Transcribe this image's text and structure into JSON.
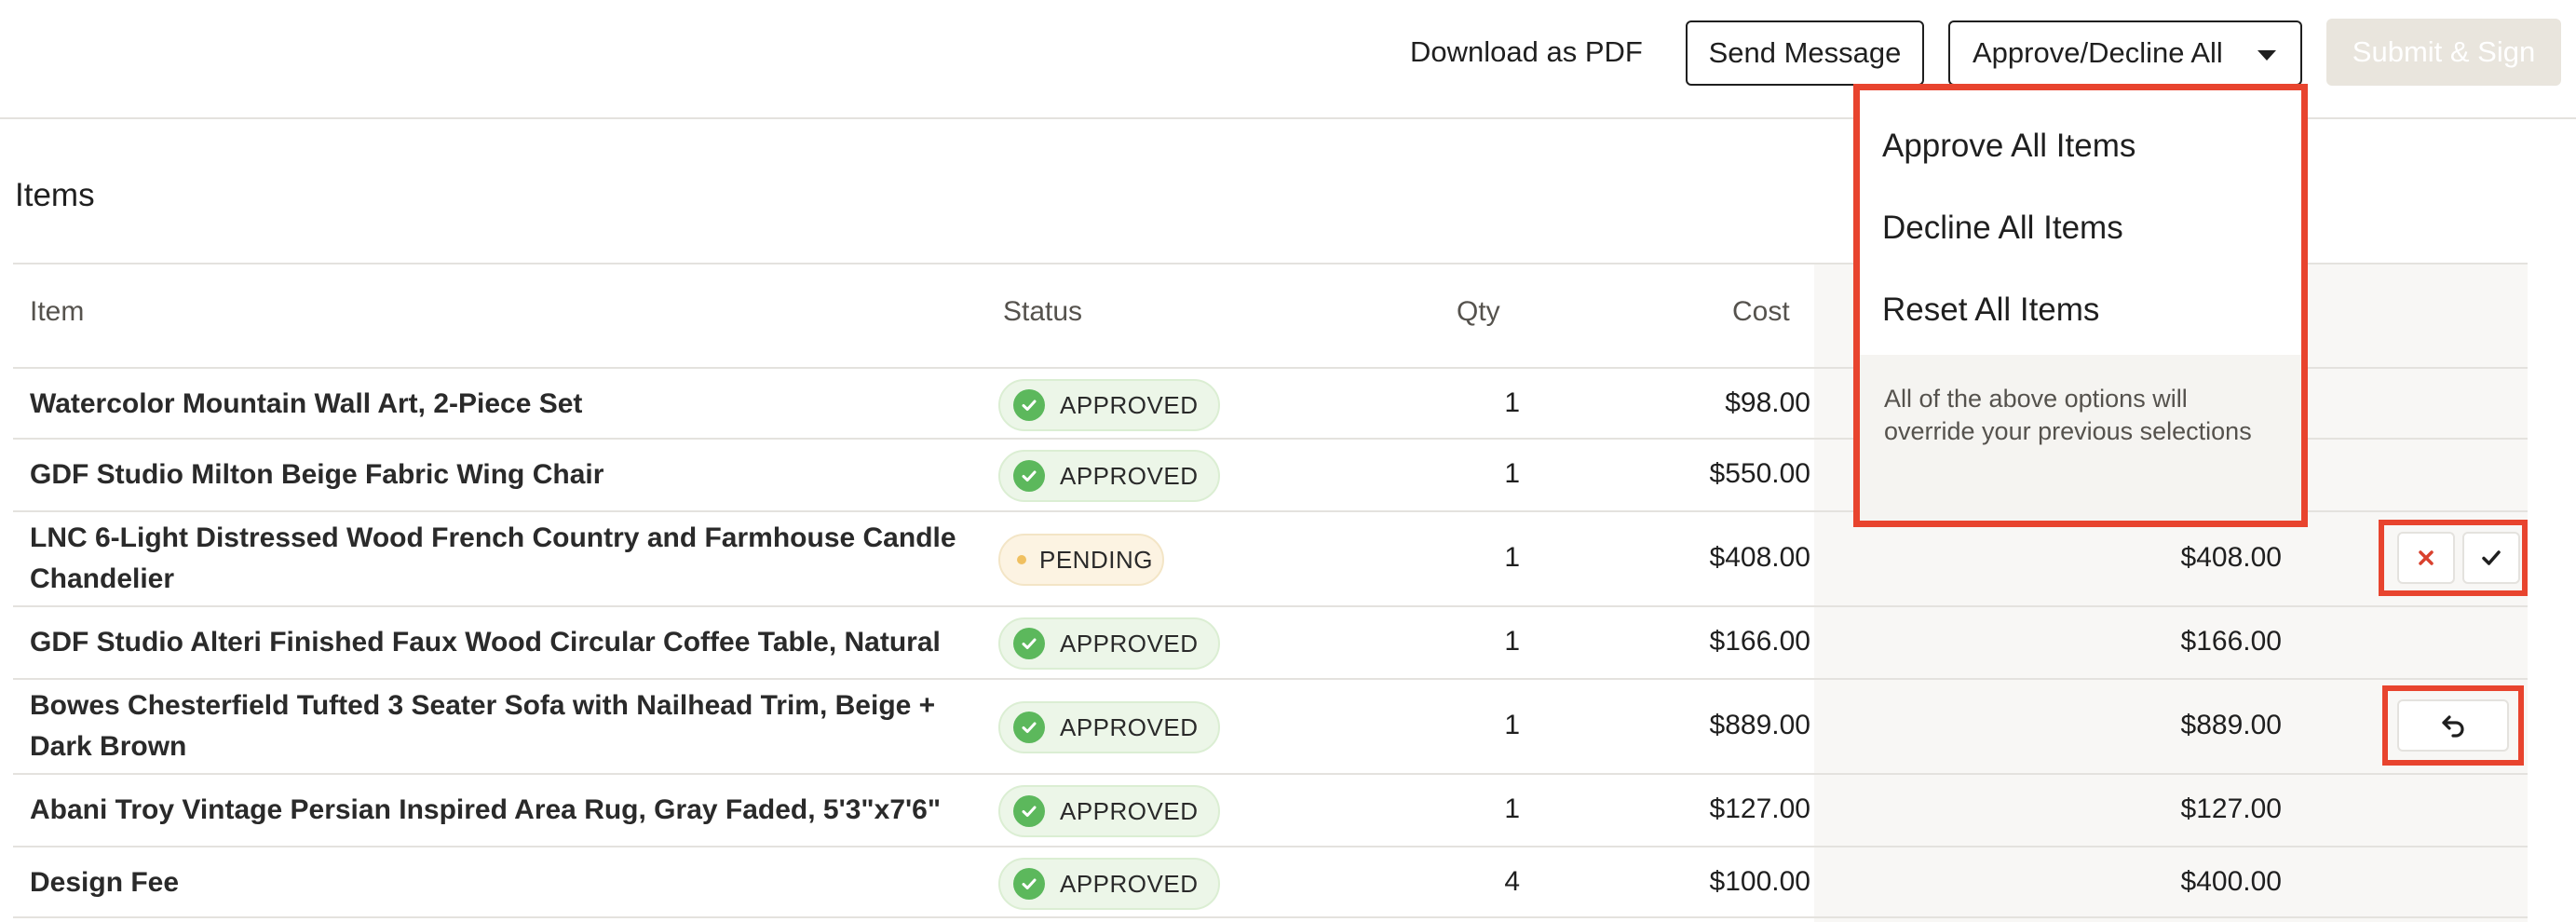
{
  "topbar": {
    "download_label": "Download as PDF",
    "send_label": "Send Message",
    "approve_decline_label": "Approve/Decline All",
    "submit_label": "Submit & Sign"
  },
  "items_section": {
    "title": "Items",
    "columns": {
      "item": "Item",
      "status": "Status",
      "qty": "Qty",
      "cost": "Cost"
    },
    "rows": [
      {
        "name": "Watercolor Mountain Wall Art, 2-Piece Set",
        "status": "APPROVED",
        "qty": "1",
        "cost": "$98.00",
        "total": ""
      },
      {
        "name": "GDF Studio Milton Beige Fabric Wing Chair",
        "status": "APPROVED",
        "qty": "1",
        "cost": "$550.00",
        "total": ""
      },
      {
        "name": "LNC 6-Light Distressed Wood French Country and Farmhouse Candle Chandelier",
        "status": "PENDING",
        "qty": "1",
        "cost": "$408.00",
        "total": "$408.00"
      },
      {
        "name": "GDF Studio Alteri Finished Faux Wood Circular Coffee Table, Natural",
        "status": "APPROVED",
        "qty": "1",
        "cost": "$166.00",
        "total": "$166.00"
      },
      {
        "name": "Bowes Chesterfield Tufted 3 Seater Sofa with Nailhead Trim, Beige + Dark Brown",
        "status": "APPROVED",
        "qty": "1",
        "cost": "$889.00",
        "total": "$889.00"
      },
      {
        "name": "Abani Troy Vintage Persian Inspired Area Rug, Gray Faded, 5'3\"x7'6\"",
        "status": "APPROVED",
        "qty": "1",
        "cost": "$127.00",
        "total": "$127.00"
      },
      {
        "name": "Design Fee",
        "status": "APPROVED",
        "qty": "4",
        "cost": "$100.00",
        "total": "$400.00"
      }
    ]
  },
  "dropdown": {
    "items": [
      "Approve All Items",
      "Decline All Items",
      "Reset All Items"
    ],
    "note": "All of the above options will override your previous selections"
  },
  "icons": {
    "caret": "chevron-down-icon",
    "approved": "check-circle-icon",
    "pending": "dot-icon",
    "decline": "close-icon",
    "approve": "check-icon",
    "reset": "undo-icon"
  },
  "colors": {
    "highlight": "#e8442e",
    "approved_green": "#5cb85c",
    "pending_dot": "#f0c060",
    "decline_red": "#d9412e",
    "submit_disabled_bg": "#e9e5dd"
  }
}
